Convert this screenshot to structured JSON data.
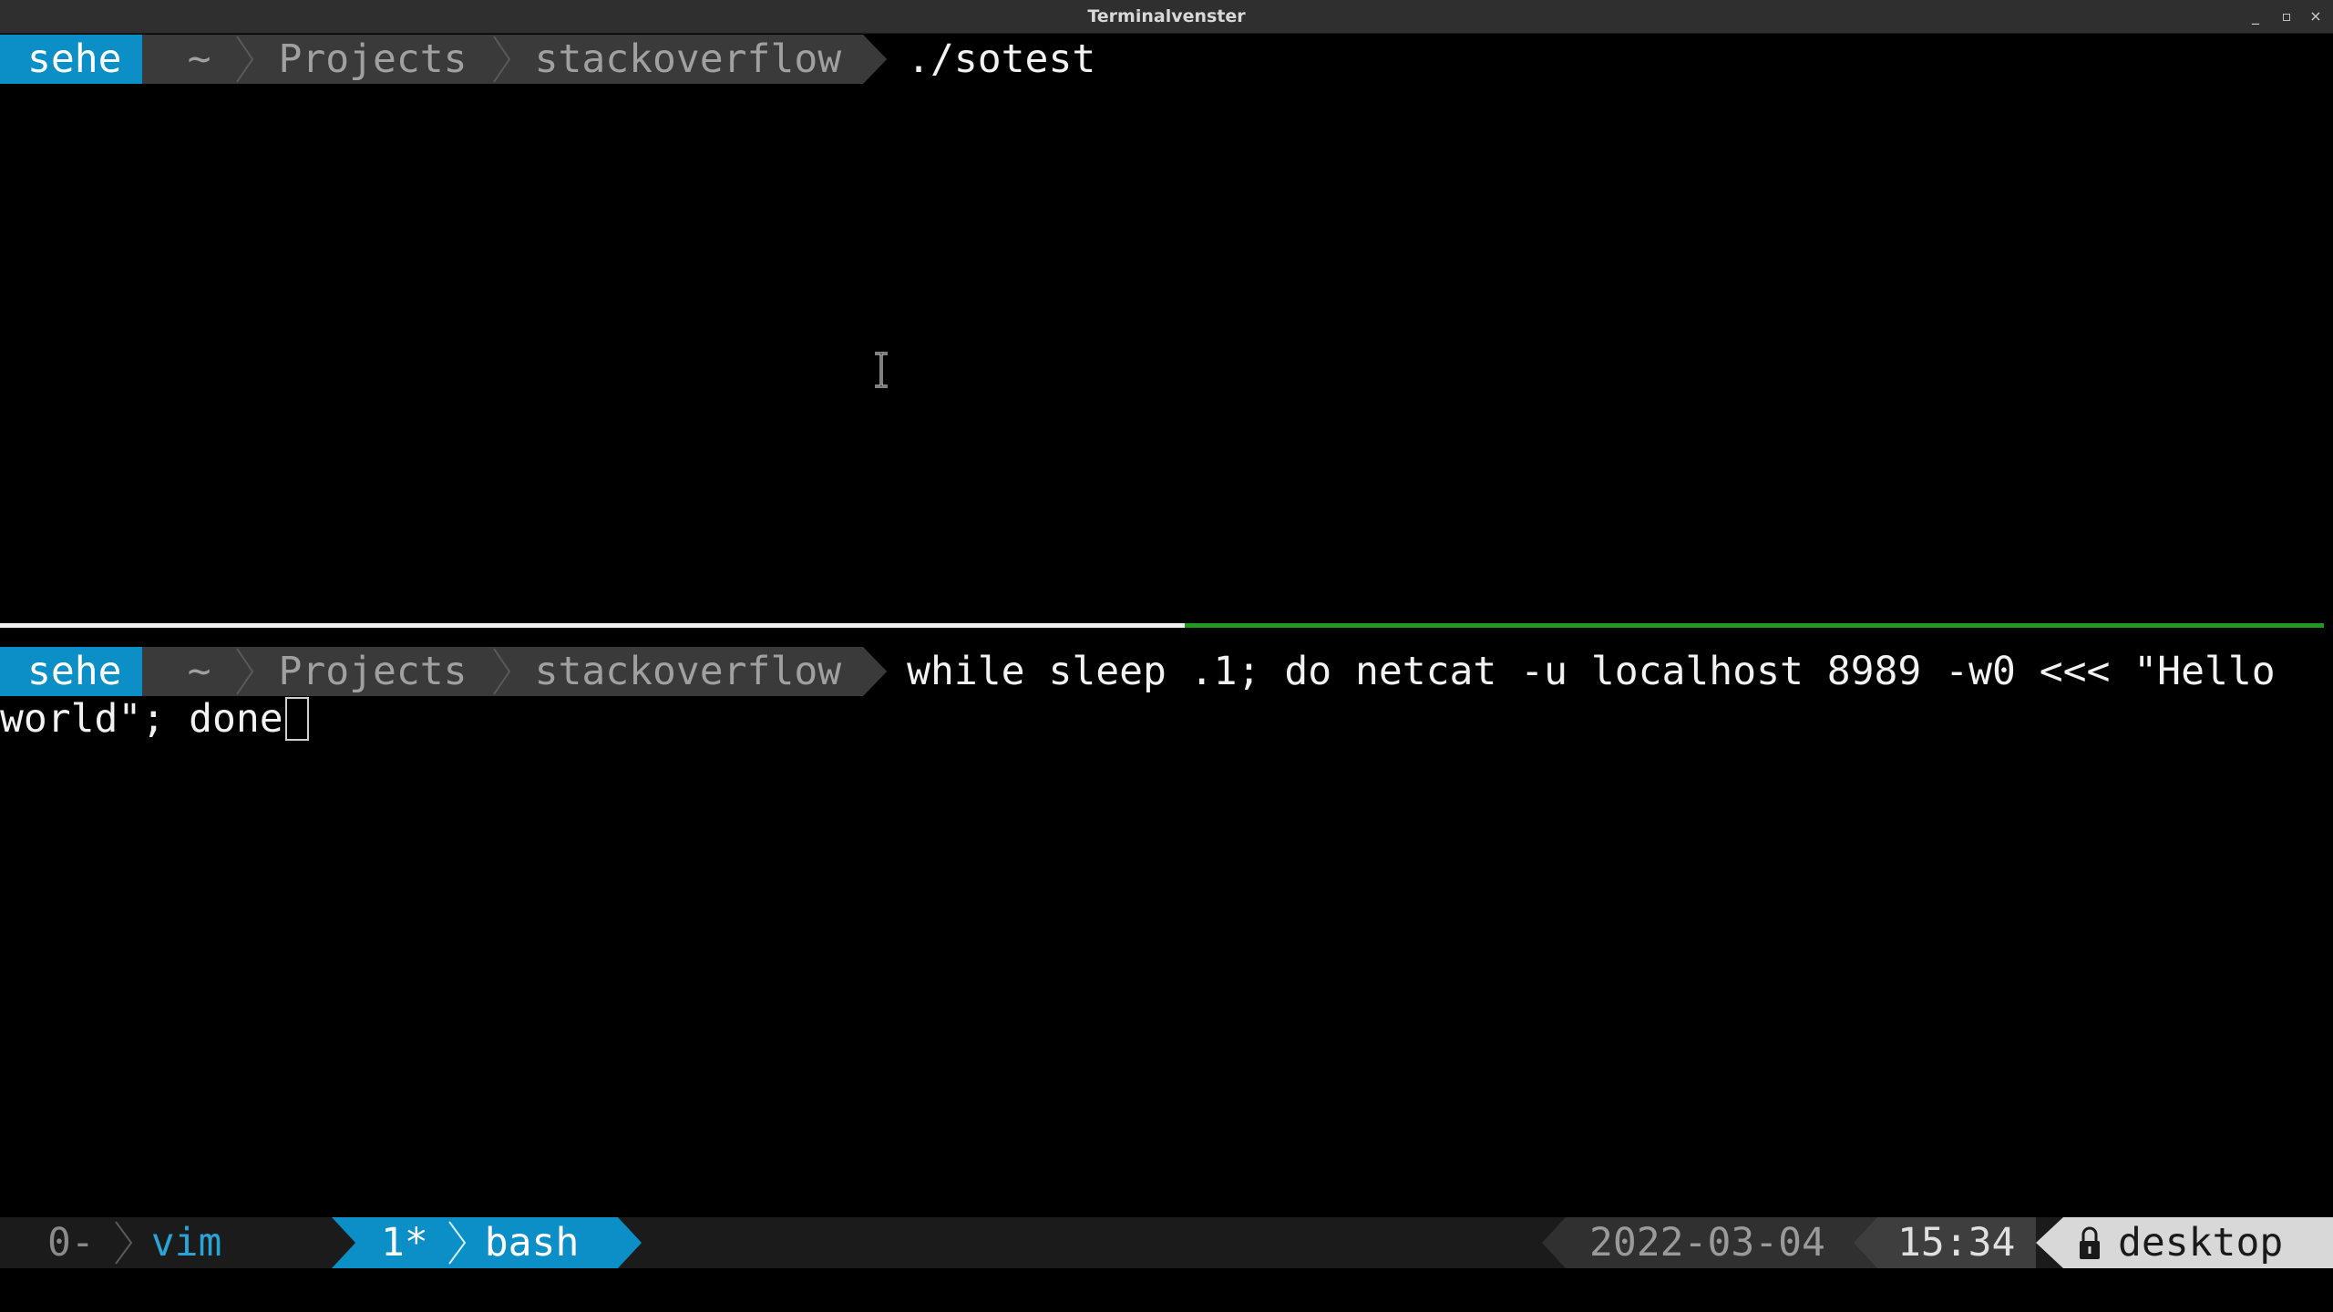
{
  "window": {
    "title": "Terminalvenster",
    "controls": [
      "_",
      "▫",
      "×"
    ]
  },
  "top_pane": {
    "prompt": {
      "user": "sehe",
      "path": [
        "~",
        "Projects",
        "stackoverflow"
      ]
    },
    "command": "./sotest"
  },
  "bottom_pane": {
    "prompt": {
      "user": "sehe",
      "path": [
        "~",
        "Projects",
        "stackoverflow"
      ]
    },
    "command_line1": "while sleep .1; do netcat -u localhost 8989 -w0 <<< \"Hello",
    "command_line2": "world\"; done"
  },
  "status_bar": {
    "windows": [
      {
        "index": "0-",
        "name": "vim",
        "active": false
      },
      {
        "index": "1*",
        "name": "bash",
        "active": true
      }
    ],
    "date": "2022-03-04",
    "time": "15:34",
    "host": "desktop"
  },
  "colors": {
    "accent": "#0b8fc6",
    "active_pane_border": "#1f9a1f",
    "background": "#000000"
  },
  "icons": {
    "separator": "chevron-right-icon",
    "lock": "lock-icon",
    "text_cursor": "ibeam-cursor-icon"
  }
}
